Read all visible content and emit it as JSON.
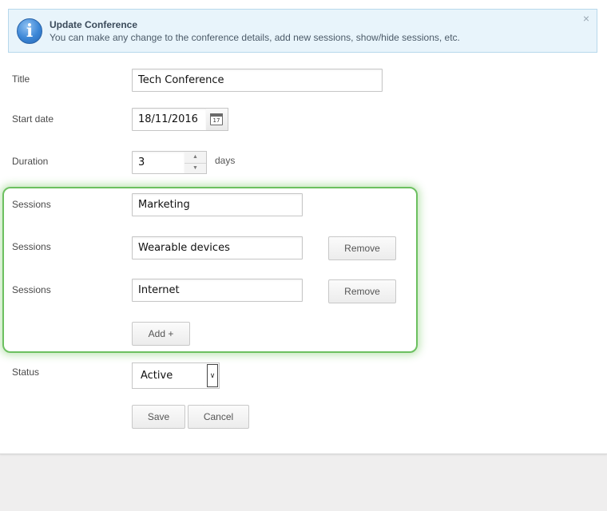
{
  "alert": {
    "icon": "info-icon",
    "icon_glyph": "i",
    "title": "Update Conference",
    "message": "You can make any change to the conference details, add new sessions, show/hide sessions, etc.",
    "close_glyph": "×"
  },
  "form": {
    "title_label": "Title",
    "title_value": "Tech Conference",
    "start_date_label": "Start date",
    "start_date_value": "18/11/2016",
    "calendar_icon_day": "17",
    "duration_label": "Duration",
    "duration_value": "3",
    "duration_suffix": "days",
    "sessions": [
      {
        "label": "Sessions",
        "value": "Marketing"
      },
      {
        "label": "Sessions",
        "value": "Wearable devices",
        "remove_label": "Remove"
      },
      {
        "label": "Sessions",
        "value": "Internet",
        "remove_label": "Remove"
      }
    ],
    "add_label": "Add +",
    "status_label": "Status",
    "status_value": "Active",
    "save_label": "Save",
    "cancel_label": "Cancel"
  },
  "colors": {
    "highlight_border": "#6cc060",
    "alert_background": "#e8f4fb",
    "page_background": "#efeeee"
  }
}
